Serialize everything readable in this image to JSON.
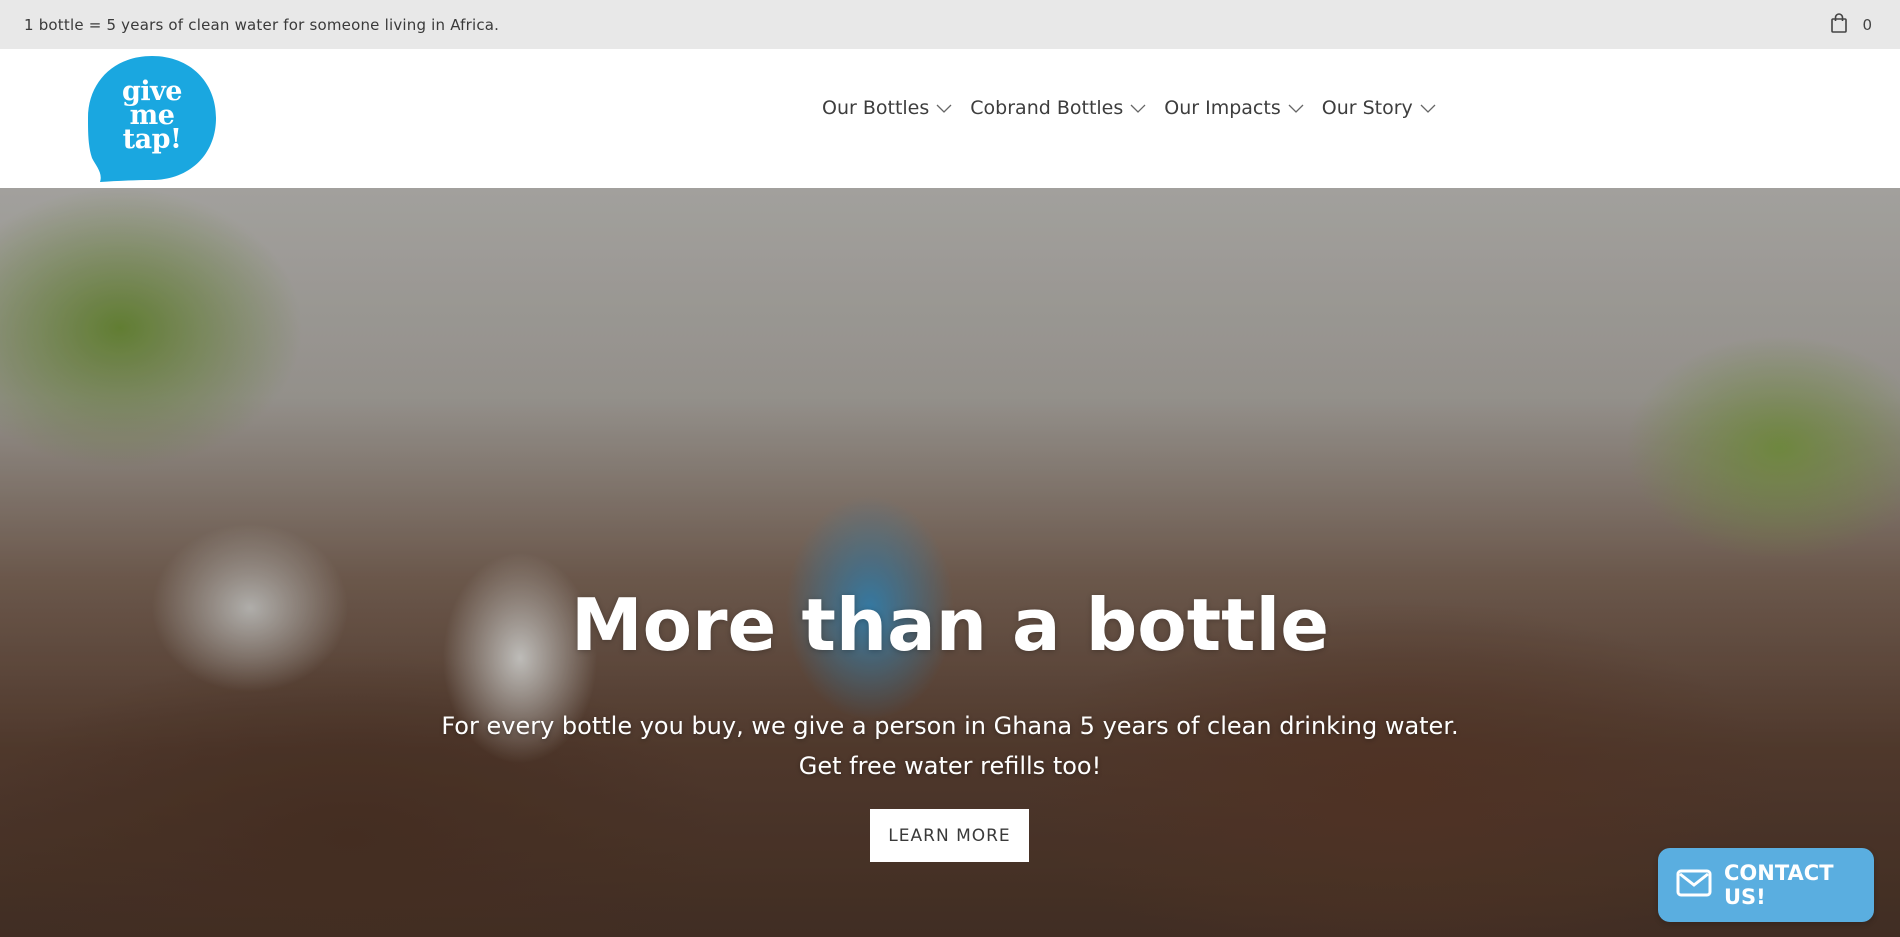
{
  "announcement": {
    "text": "1 bottle = 5 years of clean water for someone living in Africa.",
    "cart_icon": "shopping-bag-icon",
    "cart_count": "0"
  },
  "logo": {
    "line1": "give",
    "line2": "me",
    "line3": "tap!",
    "color": "#1aa7e0"
  },
  "nav": {
    "items": [
      {
        "label": "Our Bottles"
      },
      {
        "label": "Cobrand Bottles"
      },
      {
        "label": "Our Impacts"
      },
      {
        "label": "Our Story"
      }
    ],
    "dropdown_icon": "chevron-down-icon"
  },
  "hero": {
    "title": "More than a bottle",
    "subtitle_line1": "For every bottle you buy, we give a person in Ghana 5 years of clean drinking water.",
    "subtitle_line2": "Get free water refills too!",
    "button_label": "LEARN MORE"
  },
  "contact_widget": {
    "label": "CONTACT US!",
    "icon": "envelope-icon",
    "color": "#5aaee0"
  }
}
